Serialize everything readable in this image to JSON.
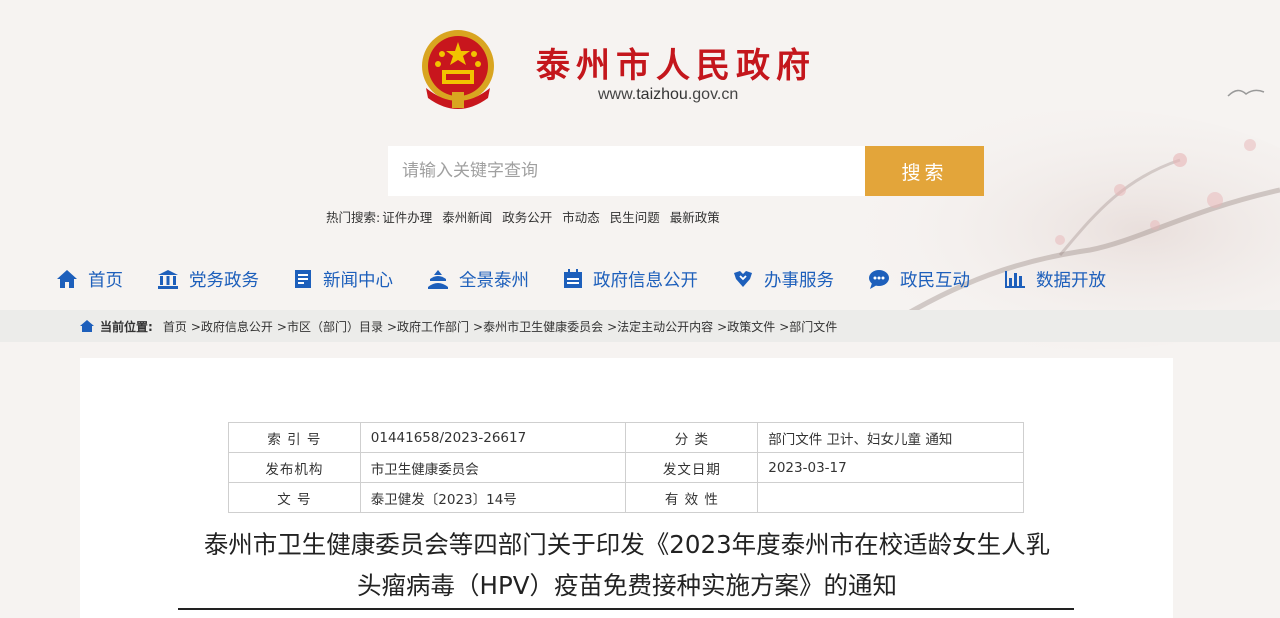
{
  "header": {
    "site_title": "泰州市人民政府",
    "site_url_prefix": "www.",
    "site_url_highlight": "taizhou",
    "site_url_suffix": ".gov.cn"
  },
  "search": {
    "placeholder": "请输入关键字查询",
    "button_label": "搜索",
    "hot_label": "热门搜索:",
    "hot_terms": [
      "证件办理",
      "泰州新闻",
      "政务公开",
      "市动态",
      "民生问题",
      "最新政策"
    ]
  },
  "nav": [
    {
      "label": "首页",
      "icon": "home-icon"
    },
    {
      "label": "党务政务",
      "icon": "building-icon"
    },
    {
      "label": "新闻中心",
      "icon": "newspaper-icon"
    },
    {
      "label": "全景泰州",
      "icon": "landmark-icon"
    },
    {
      "label": "政府信息公开",
      "icon": "calendar-icon"
    },
    {
      "label": "办事服务",
      "icon": "handshake-icon"
    },
    {
      "label": "政民互动",
      "icon": "chat-icon"
    },
    {
      "label": "数据开放",
      "icon": "bar-chart-icon"
    }
  ],
  "breadcrumb": {
    "label": "当前位置:",
    "items": [
      "首页",
      ">政府信息公开",
      ">市区（部门）目录",
      ">政府工作部门",
      ">泰州市卫生健康委员会",
      ">法定主动公开内容",
      ">政策文件",
      ">部门文件"
    ]
  },
  "meta": {
    "index_no_label": "索 引 号",
    "index_no": "01441658/2023-26617",
    "category_label": "分    类",
    "category": "部门文件 卫计、妇女儿童 通知",
    "publisher_label": "发布机构",
    "publisher": "市卫生健康委员会",
    "date_label": "发文日期",
    "date": "2023-03-17",
    "doc_no_label": "文    号",
    "doc_no": "泰卫健发〔2023〕14号",
    "validity_label": "有 效 性",
    "validity": ""
  },
  "document": {
    "title_line1": "泰州市卫生健康委员会等四部门关于印发《2023年度泰州市在校适龄女生人乳",
    "title_line2": "头瘤病毒（HPV）疫苗免费接种实施方案》的通知"
  },
  "colors": {
    "brand_red": "#c4161c",
    "nav_blue": "#1d5fbb",
    "search_button": "#e3a53a"
  }
}
